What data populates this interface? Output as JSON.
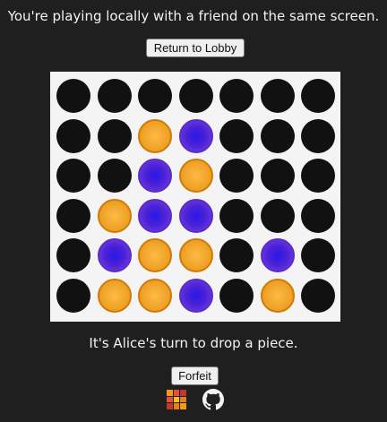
{
  "status": {
    "message": "You're playing locally with a friend on the same screen."
  },
  "lobby_button": {
    "label": "Return to Lobby"
  },
  "board": {
    "columns": 7,
    "rows": 6,
    "colors": {
      "empty": "#111111",
      "orange": "#f0a529",
      "purple": "#4a22d6",
      "board": "#f4f4f4"
    },
    "cells": [
      [
        "empty",
        "empty",
        "empty",
        "empty",
        "empty",
        "empty",
        "empty"
      ],
      [
        "empty",
        "empty",
        "orange",
        "purple",
        "empty",
        "empty",
        "empty"
      ],
      [
        "empty",
        "empty",
        "purple",
        "orange",
        "empty",
        "empty",
        "empty"
      ],
      [
        "empty",
        "orange",
        "purple",
        "purple",
        "empty",
        "empty",
        "empty"
      ],
      [
        "empty",
        "purple",
        "orange",
        "orange",
        "empty",
        "purple",
        "empty"
      ],
      [
        "empty",
        "orange",
        "orange",
        "purple",
        "empty",
        "orange",
        "empty"
      ]
    ]
  },
  "turn": {
    "message": "It's Alice's turn to drop a piece."
  },
  "forfeit_button": {
    "label": "Forfeit"
  },
  "footer": {
    "app_icon": "grid-logo-icon",
    "github_icon": "github-icon"
  }
}
